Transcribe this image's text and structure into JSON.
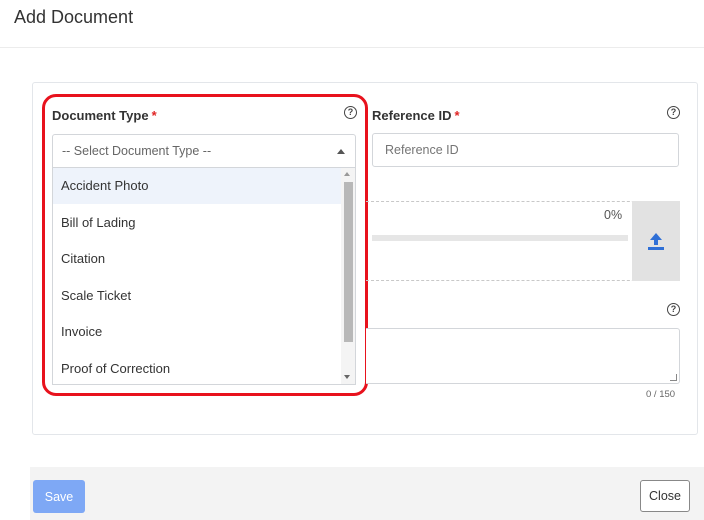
{
  "modal": {
    "title": "Add Document"
  },
  "document_type": {
    "label": "Document Type",
    "required_mark": "*",
    "help_icon": "question-circle-icon",
    "select_placeholder": "-- Select Document Type --",
    "options": [
      "Accident Photo",
      "Bill of Lading",
      "Citation",
      "Scale Ticket",
      "Invoice",
      "Proof of Correction"
    ],
    "highlighted_option": "Accident Photo"
  },
  "reference_id": {
    "label": "Reference ID",
    "required_mark": "*",
    "help_icon": "question-circle-icon",
    "placeholder": "Reference ID"
  },
  "upload": {
    "progress_text": "0%",
    "progress_fraction": 0,
    "icon": "upload-icon"
  },
  "notes": {
    "help_icon": "question-circle-icon",
    "char_count": "0 / 150"
  },
  "footer": {
    "save_label": "Save",
    "close_label": "Close"
  },
  "colors": {
    "highlight_ring": "#e8121d",
    "save_button": "#7ea8f5",
    "upload_icon": "#2f6fd6",
    "required": "#e02424"
  }
}
